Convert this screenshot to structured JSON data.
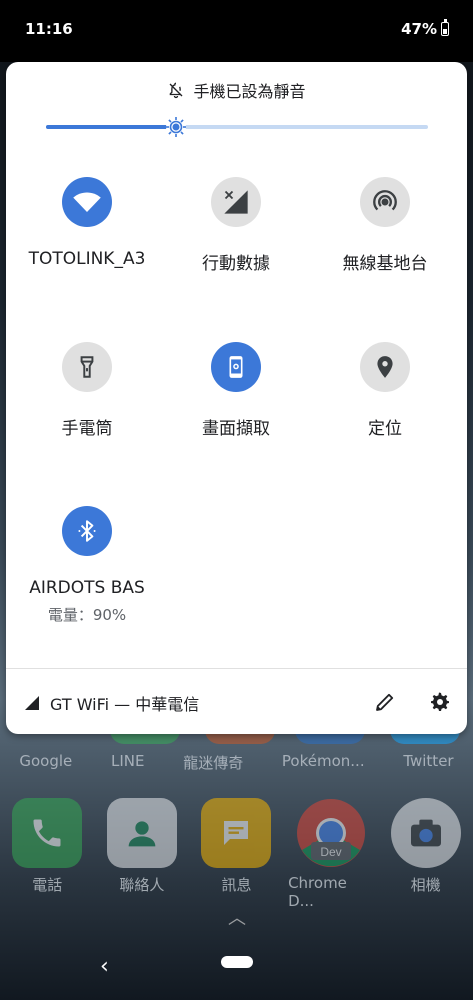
{
  "status_bar": {
    "time": "11:16",
    "battery": "47%"
  },
  "quick_settings": {
    "dnd_text": "手機已設為靜音",
    "brightness_level": 0.34,
    "tiles": [
      {
        "label": "TOTOLINK_A3",
        "icon": "wifi-icon",
        "active": true
      },
      {
        "label": "行動數據",
        "icon": "mobile-data-icon",
        "active": false
      },
      {
        "label": "無線基地台",
        "icon": "hotspot-icon",
        "active": false
      },
      {
        "label": "手電筒",
        "icon": "flashlight-icon",
        "active": false
      },
      {
        "label": "畫面擷取",
        "icon": "screen-capture-icon",
        "active": true
      },
      {
        "label": "定位",
        "icon": "location-icon",
        "active": false
      },
      {
        "label": "AIRDOTS BAS",
        "sublabel": "電量：90%",
        "icon": "bluetooth-icon",
        "active": true
      }
    ],
    "footer": {
      "carrier": "GT WiFi — 中華電信"
    },
    "accent_color": "#3c78d8"
  },
  "home_screen": {
    "app_row_labels": [
      "Google",
      "LINE",
      "龍迷傳奇",
      "Pokémon...",
      "Twitter"
    ],
    "dock": [
      {
        "label": "電話",
        "icon": "phone-icon"
      },
      {
        "label": "聯絡人",
        "icon": "contacts-icon"
      },
      {
        "label": "訊息",
        "icon": "messages-icon"
      },
      {
        "label": "Chrome D...",
        "icon": "chrome-dev-icon",
        "badge": "Dev"
      },
      {
        "label": "相機",
        "icon": "camera-icon"
      }
    ]
  }
}
